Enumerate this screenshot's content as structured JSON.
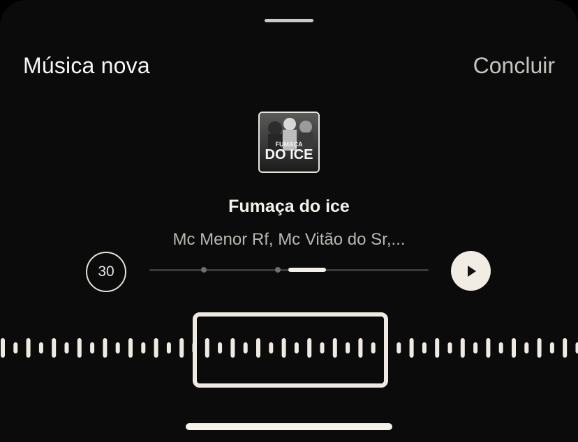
{
  "header": {
    "title": "Música nova",
    "done_label": "Concluir"
  },
  "track": {
    "title": "Fumaça do ice",
    "artists": "Mc Menor Rf, Mc Vitão do Sr,...",
    "album_art_text": "FUMAÇA DO ICE"
  },
  "player": {
    "duration_label": "30",
    "play_icon": "play-icon",
    "selection_start_fraction": 0.5,
    "selection_length_fraction": 0.13
  },
  "colors": {
    "background": "#0b0b0b",
    "accent": "#f1ede4",
    "muted_text": "#b9b7b0"
  }
}
